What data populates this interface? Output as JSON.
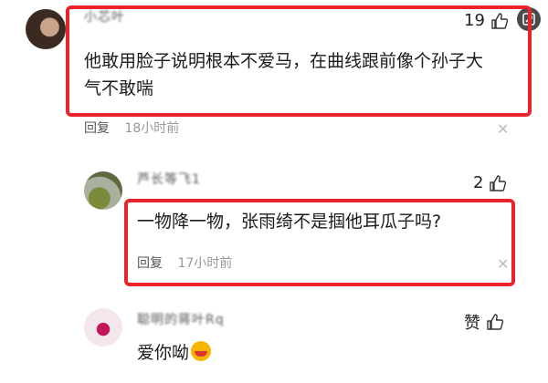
{
  "comments": [
    {
      "username": "小芯叶",
      "likes": "19",
      "text_line1": "他敢用脸子说明根本不爱马，在曲线跟前像个孙子大",
      "text_line2": "气不敢喘",
      "reply_label": "回复",
      "time": "18小时前"
    },
    {
      "username": "芦长等飞1",
      "likes": "2",
      "text_line1": "一物降一物，张雨绮不是掴他耳瓜子吗?",
      "reply_label": "回复",
      "time": "17小时前"
    },
    {
      "username": "聪明的蒋叶Rq",
      "likes": "赞",
      "text_line1": "爱你呦"
    }
  ],
  "colors": {
    "highlight": "#e8232b",
    "time": "#999999"
  },
  "icons": {
    "like": "thumbs-up-icon",
    "close": "close-icon",
    "corner": "image-search-icon",
    "emoji": "kiss-emoji-icon"
  }
}
